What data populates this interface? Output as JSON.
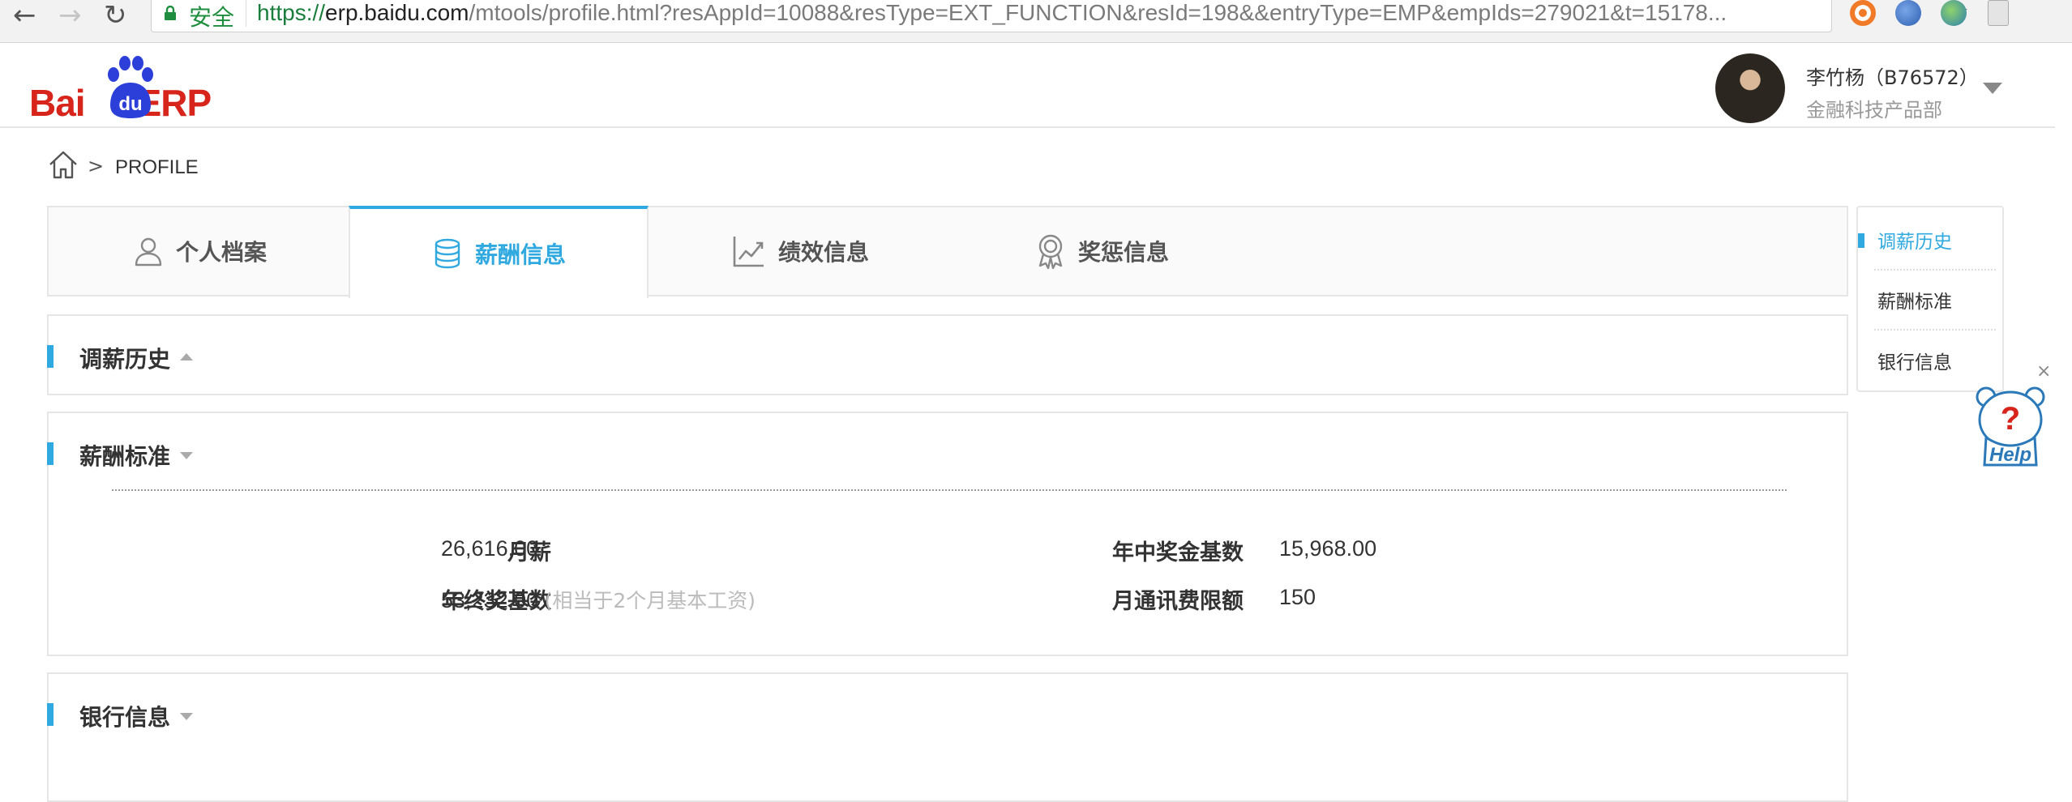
{
  "browser": {
    "security_label": "安全",
    "url_scheme": "https://",
    "url_host": "erp.baidu.com",
    "url_path": "/mtools/profile.html?resAppId=10088&resType=EXT_FUNCTION&resId=198&&entryType=EMP&empIds=279021&t=15178..."
  },
  "header": {
    "logo_text_left": "Bai",
    "logo_text_du": "du",
    "logo_text_right": "ERP",
    "user_name": "李竹杨（B76572）",
    "user_dept": "金融科技产品部"
  },
  "breadcrumb": {
    "separator": ">",
    "current": "PROFILE"
  },
  "tabs": [
    {
      "label": "个人档案",
      "icon": "person-icon",
      "active": false
    },
    {
      "label": "薪酬信息",
      "icon": "database-icon",
      "active": true
    },
    {
      "label": "绩效信息",
      "icon": "trend-chart-icon",
      "active": false
    },
    {
      "label": "奖惩信息",
      "icon": "award-medal-icon",
      "active": false
    }
  ],
  "sections": {
    "salary_history": {
      "title": "调薪历史"
    },
    "salary_standard": {
      "title": "薪酬标准",
      "fields": {
        "monthly_salary_label": "月薪",
        "monthly_salary_value": "26,616.00",
        "midyear_bonus_label": "年中奖金基数",
        "midyear_bonus_value": "15,968.00",
        "yearend_bonus_label": "年终奖基数",
        "yearend_bonus_value": "53,232.00",
        "yearend_bonus_note": "(相当于2个月基本工资)",
        "phone_allowance_label": "月通讯费限额",
        "phone_allowance_value": "150"
      }
    },
    "bank_info": {
      "title": "银行信息"
    }
  },
  "anchor_nav": [
    {
      "label": "调薪历史",
      "active": true
    },
    {
      "label": "薪酬标准",
      "active": false
    },
    {
      "label": "银行信息",
      "active": false
    }
  ],
  "help": {
    "close_glyph": "×"
  },
  "colors": {
    "accent": "#2fa9e0",
    "brand_red": "#d7251c",
    "brand_blue": "#2c3fd8"
  }
}
